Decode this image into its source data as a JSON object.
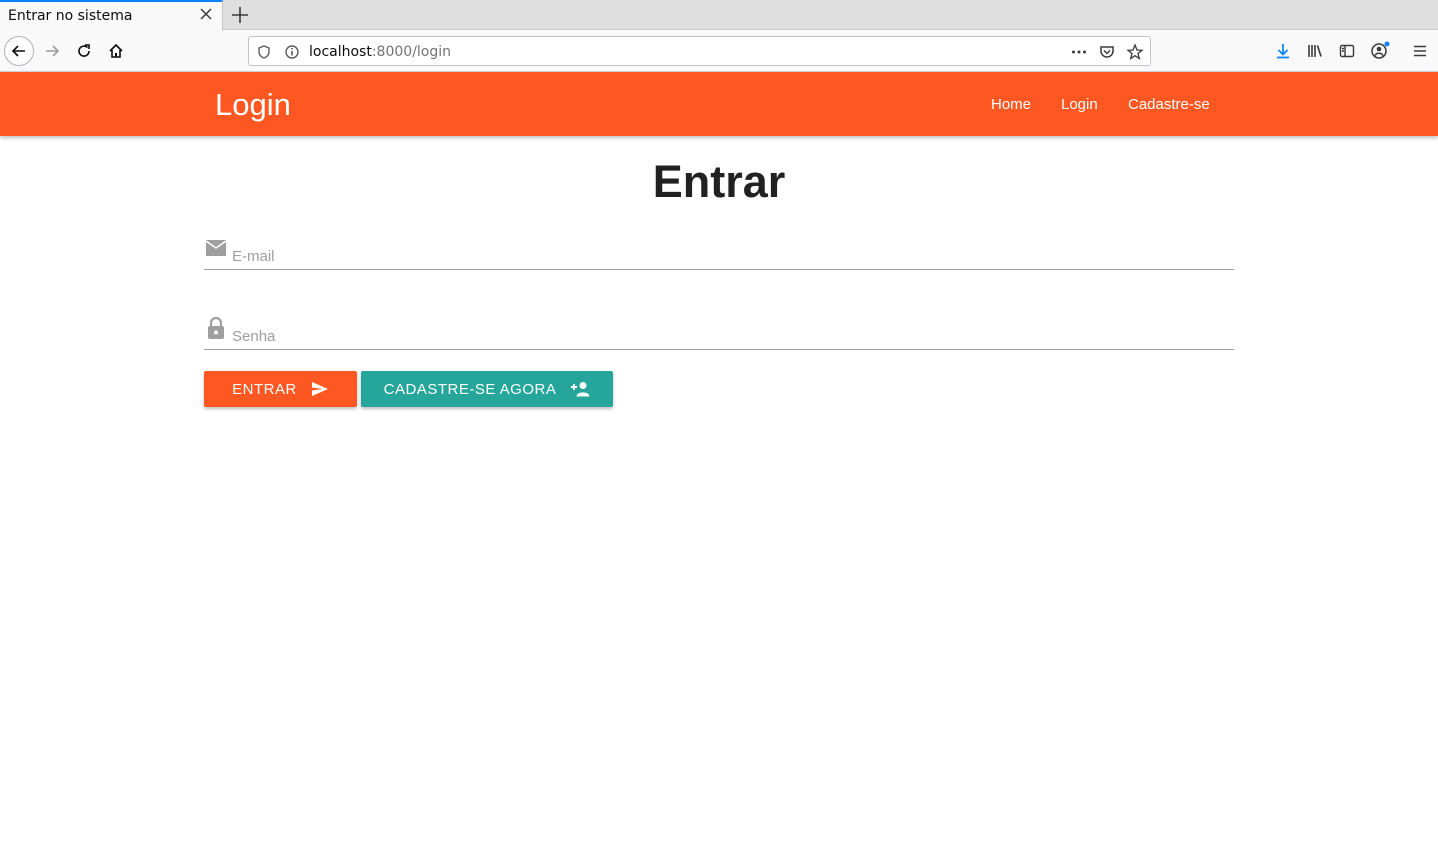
{
  "browser": {
    "tab_title": "Entrar no sistema",
    "url_host": "localhost",
    "url_path": ":8000/login",
    "accent_color": "#0a84ff"
  },
  "appbar": {
    "brand": "Login",
    "color": "#ff5722",
    "menu": [
      "Home",
      "Login",
      "Cadastre-se"
    ]
  },
  "main": {
    "title": "Entrar",
    "email_placeholder": "E-mail",
    "password_placeholder": "Senha",
    "submit_label": "ENTRAR",
    "register_label": "CADASTRE-SE AGORA",
    "submit_color": "#ff5722",
    "register_color": "#26a69a"
  },
  "icons": {
    "email": "mail-icon",
    "password": "lock-icon",
    "submit": "send-icon",
    "register": "person-add-icon"
  }
}
